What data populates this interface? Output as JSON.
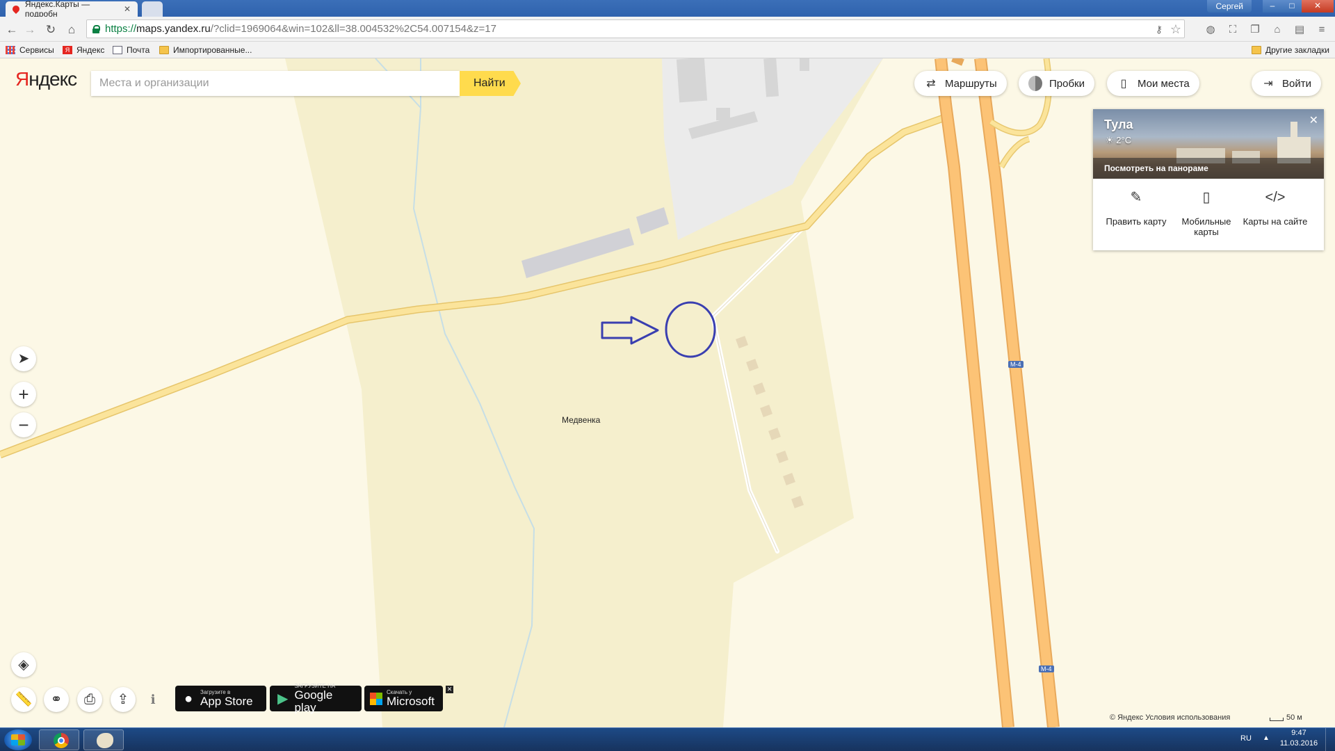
{
  "browser": {
    "tab_title": "Яндекс.Карты — подробн",
    "tab_close": "✕",
    "user": "Сергей",
    "controls": {
      "minimize": "‒",
      "maximize": "□",
      "close": "✕"
    },
    "url": {
      "scheme": "https://",
      "host": "maps.yandex.ru",
      "path": "/?clid=1969064&win=102&ll=38.004532%2C54.007154&z=17"
    },
    "bookmarks": [
      {
        "label": "Сервисы",
        "icon": "apps-icon"
      },
      {
        "label": "Яндекс",
        "icon": "yandex-icon"
      },
      {
        "label": "Почта",
        "icon": "mail-icon"
      },
      {
        "label": "Импортированные...",
        "icon": "folder-icon"
      }
    ],
    "other_bookmarks": "Другие закладки"
  },
  "header": {
    "logo_first": "Я",
    "logo_rest": "ндекс",
    "search_placeholder": "Места и организации",
    "search_button": "Найти"
  },
  "top_controls": {
    "routes": "Маршруты",
    "traffic": "Пробки",
    "my_places": "Мои места",
    "login": "Войти"
  },
  "panel": {
    "city": "Тула",
    "weather": "☀ 2°C",
    "panorama_link": "Посмотреть на панораме",
    "items": [
      {
        "label": "Править карту",
        "icon": "edit-icon"
      },
      {
        "label": "Мобильные карты",
        "icon": "phone-icon"
      },
      {
        "label": "Карты на сайте",
        "icon": "code-icon"
      }
    ]
  },
  "map": {
    "place_label": "Медвенка",
    "road_shield": "М-4"
  },
  "stores": {
    "appstore_small": "Загрузите в",
    "appstore_big": "App Store",
    "googleplay_small": "ЗАГРУЗИТЕ НА",
    "googleplay_big": "Google play",
    "microsoft_small": "Скачать у",
    "microsoft_big": "Microsoft"
  },
  "footer": {
    "copyright": "© Яндекс",
    "terms": "Условия использования",
    "scale": "50 м"
  },
  "taskbar": {
    "lang": "RU",
    "time": "9:47",
    "date": "11.03.2016"
  },
  "annotation": {
    "arrow_color": "#3a3fb0",
    "circle_color": "#3a3fb0"
  }
}
